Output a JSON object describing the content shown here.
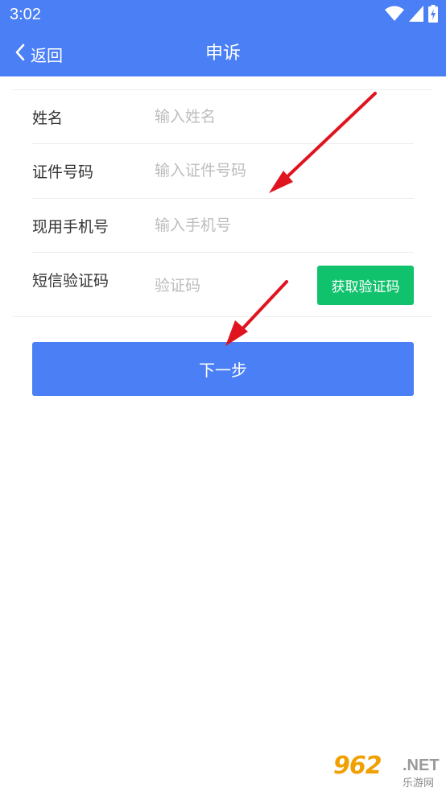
{
  "status_bar": {
    "time": "3:02",
    "icons": [
      "wifi-icon",
      "signal-icon",
      "battery-charging-icon"
    ]
  },
  "app_bar": {
    "back_label": "返回",
    "title": "申诉",
    "background": "#4a7ff5"
  },
  "form": {
    "name": {
      "label": "姓名",
      "placeholder": "输入姓名",
      "value": ""
    },
    "id_number": {
      "label": "证件号码",
      "placeholder": "输入证件号码",
      "value": ""
    },
    "phone": {
      "label": "现用手机号",
      "placeholder": "输入手机号",
      "value": ""
    },
    "sms_code": {
      "label": "短信验证码",
      "placeholder": "验证码",
      "value": "",
      "button_label": "获取验证码",
      "button_color": "#11c26d"
    }
  },
  "next_button": {
    "label": "下一步",
    "color": "#4a7ff5"
  },
  "annotations": {
    "arrow_color": "#e0141e"
  },
  "watermark": {
    "logo": "962",
    "net": ".NET",
    "sub": "乐游网"
  }
}
